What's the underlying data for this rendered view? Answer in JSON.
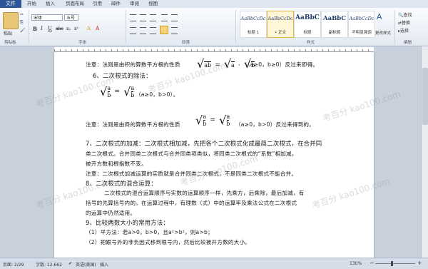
{
  "tabs": [
    "文件",
    "开始",
    "插入",
    "页面布局",
    "引用",
    "邮件",
    "审阅",
    "视图"
  ],
  "clipboard": {
    "paste": "粘贴",
    "group": "剪贴板"
  },
  "font": {
    "name": "宋体",
    "size": "五号",
    "group": "字体",
    "buttons": [
      "B",
      "I",
      "U",
      "abc",
      "x₂",
      "x²",
      "A",
      "A"
    ]
  },
  "paragraph": {
    "group": "段落"
  },
  "styles": {
    "group": "样式",
    "items": [
      {
        "sample": "AaBbCcDc",
        "name": "标题 1"
      },
      {
        "sample": "AaBbCcDc",
        "name": "• 正文"
      },
      {
        "sample": "AaBbC",
        "name": "标题"
      },
      {
        "sample": "AaBbC",
        "name": "副标题"
      },
      {
        "sample": "AaBbCcDc",
        "name": "不明显强调"
      }
    ],
    "change": "更改样式"
  },
  "editing": {
    "group": "编辑",
    "find": "查找",
    "replace": "替换",
    "select": "选择"
  },
  "document": {
    "lines": [
      "注意：法则是由积的算数平方根的性质",
      "（a≥0，b≥0）反过来即得。",
      "6、二次根式的除法：",
      "（a≥0，b>0）。",
      "注意：法则是由商的算数平方根的性质",
      "（a≥0，b>0）反过来得到的。",
      "7、二次根式的加减：二次根式相加减，先把各个二次根式化成最简二次根式，在合并同",
      "类二次根式。合并同类二次根式与合并同类项类似，将同类二次根式的“系数”相加减，",
      "被开方数和根指数不变。",
      "注意：二次根式加减运算的实质就是合并同类二次根式，不是同类二次根式不能合并。",
      "8、二次根式的混合运算：",
      "二次根式的混合运算顺序与实数的运算顺序一样，先乘方，后乘除，最后加减，有",
      "括号的先算括号内的。在运算过程中，有理数（式）中的运算率及乘法公式在二次根式",
      "的运算中仍然适用。",
      "9、比较两数大小的常用方法：",
      "（1）平方法：若a>0，b>0，且a²>b²，则a>b；",
      "（2）把跟号外的非负因式移到根号内，然后比较被开方数的大小。"
    ],
    "formula1": {
      "lhs": "ab",
      "m1": "a",
      "m2": "b"
    },
    "formula2": {
      "n1": "a",
      "d1": "b",
      "n2": "a",
      "d2": "b"
    },
    "formula3": {
      "n1": "a",
      "d1": "b",
      "n2": "a",
      "d2": "b"
    },
    "watermark": "考百分 kao100.com"
  },
  "status": {
    "page": "页面: 2/29",
    "words": "字数: 12,662",
    "lang": "英语(美国)",
    "mode": "插入",
    "zoom": "130%"
  }
}
